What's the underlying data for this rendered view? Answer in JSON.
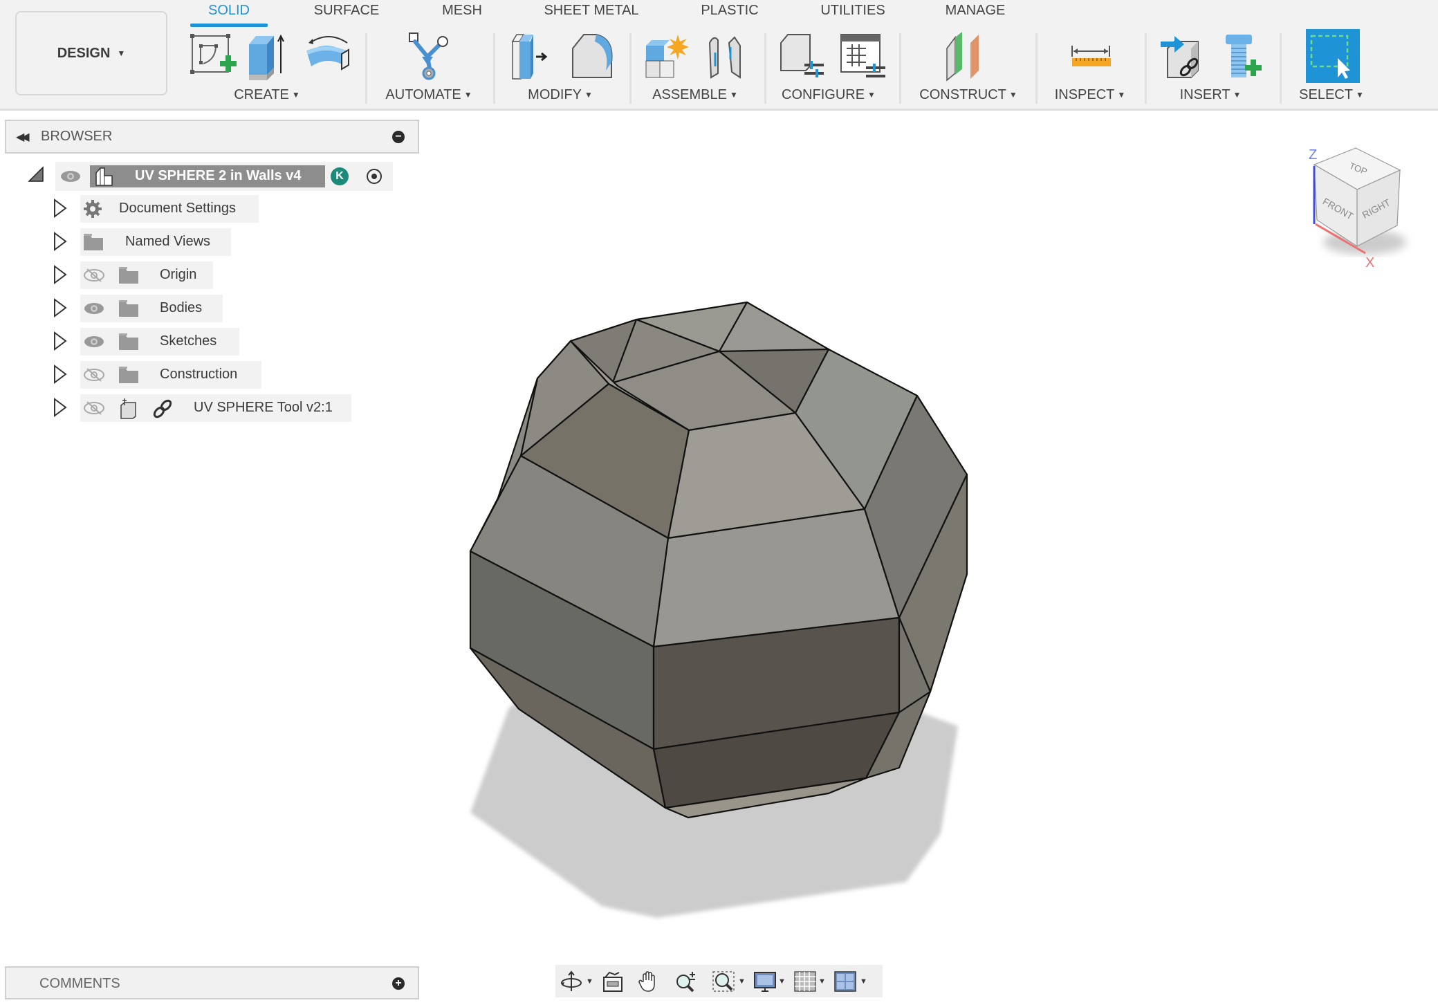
{
  "workspace_button": {
    "label": "DESIGN",
    "icon": "caret-down-icon"
  },
  "tabs": [
    {
      "label": "SOLID",
      "active": true
    },
    {
      "label": "SURFACE",
      "active": false
    },
    {
      "label": "MESH",
      "active": false
    },
    {
      "label": "SHEET METAL",
      "active": false
    },
    {
      "label": "PLASTIC",
      "active": false
    },
    {
      "label": "UTILITIES",
      "active": false
    },
    {
      "label": "MANAGE",
      "active": false
    }
  ],
  "groups": [
    {
      "label": "CREATE",
      "tools": [
        "create-sketch-icon",
        "extrude-icon",
        "revolve-icon"
      ]
    },
    {
      "label": "AUTOMATE",
      "tools": [
        "automate-icon"
      ]
    },
    {
      "label": "MODIFY",
      "tools": [
        "press-pull-icon",
        "fillet-icon"
      ]
    },
    {
      "label": "ASSEMBLE",
      "tools": [
        "new-component-icon",
        "joint-icon"
      ]
    },
    {
      "label": "CONFIGURE",
      "tools": [
        "configure-icon",
        "configure-table-icon"
      ]
    },
    {
      "label": "CONSTRUCT",
      "tools": [
        "offset-plane-icon"
      ]
    },
    {
      "label": "INSPECT",
      "tools": [
        "measure-icon"
      ]
    },
    {
      "label": "INSERT",
      "tools": [
        "insert-derive-icon",
        "insert-mcmaster-icon"
      ]
    },
    {
      "label": "SELECT",
      "tools": [
        "select-icon"
      ]
    }
  ],
  "accent_color": "#1e93d6",
  "browser": {
    "title": "BROWSER",
    "root": {
      "label": "UV SPHERE 2 in Walls v4",
      "avatar_letter": "K"
    },
    "items": [
      {
        "label": "Document Settings",
        "visible": null,
        "icon": "gear-icon"
      },
      {
        "label": "Named Views",
        "visible": null,
        "icon": "folder-icon"
      },
      {
        "label": "Origin",
        "visible": false,
        "icon": "folder-icon"
      },
      {
        "label": "Bodies",
        "visible": true,
        "icon": "folder-icon"
      },
      {
        "label": "Sketches",
        "visible": true,
        "icon": "folder-icon"
      },
      {
        "label": "Construction",
        "visible": false,
        "icon": "folder-icon"
      },
      {
        "label": "UV SPHERE Tool v2:1",
        "visible": false,
        "icon": "linked-component-icon"
      }
    ]
  },
  "comments": {
    "title": "COMMENTS"
  },
  "viewcube": {
    "faces": [
      "TOP",
      "FRONT",
      "RIGHT"
    ],
    "axes": [
      "Z",
      "X"
    ]
  },
  "nav_tools": [
    "orbit-icon",
    "look-at-icon",
    "pan-icon",
    "zoom-icon",
    "fit-icon",
    "display-settings-icon",
    "grid-icon",
    "viewports-icon"
  ]
}
